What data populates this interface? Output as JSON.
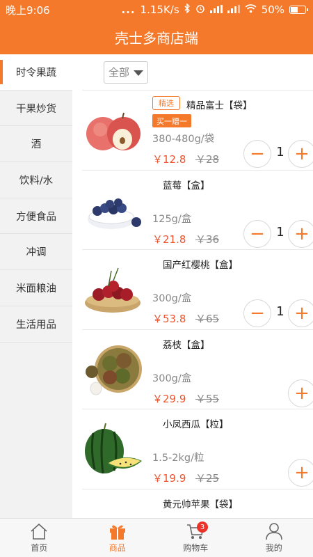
{
  "status_bar": {
    "time": "晚上9:06",
    "dots": "...",
    "network_speed": "1.15K/s",
    "battery": "50%",
    "battery_level": 0.5
  },
  "header": {
    "title": "壳士多商店端"
  },
  "colors": {
    "accent": "#f5792a",
    "price": "#f0532c",
    "badge": "#e8322a"
  },
  "sidebar": {
    "items": [
      {
        "label": "时令果蔬",
        "active": true
      },
      {
        "label": "干果炒货"
      },
      {
        "label": "酒"
      },
      {
        "label": "饮料/水"
      },
      {
        "label": "方便食品"
      },
      {
        "label": "冲调"
      },
      {
        "label": "米面粮油"
      },
      {
        "label": "生活用品"
      }
    ]
  },
  "filter": {
    "selected": "全部"
  },
  "products": [
    {
      "name": "精品富士【袋】",
      "tag": "精选",
      "promo": "买一赠一",
      "spec": "380-480g/袋",
      "price": "￥12.8",
      "old_price": "￥28",
      "qty": "1",
      "image": "apple"
    },
    {
      "name": "蓝莓【盒】",
      "spec": "125g/盒",
      "price": "￥21.8",
      "old_price": "￥36",
      "qty": "1",
      "image": "blueberry"
    },
    {
      "name": "国产红樱桃【盒】",
      "spec": "300g/盒",
      "price": "￥53.8",
      "old_price": "￥65",
      "qty": "1",
      "image": "cherry"
    },
    {
      "name": "荔枝【盒】",
      "spec": "300g/盒",
      "price": "￥29.9",
      "old_price": "￥55",
      "image": "lychee"
    },
    {
      "name": "小凤西瓜【粒】",
      "spec": "1.5-2kg/粒",
      "price": "￥19.9",
      "old_price": "￥25",
      "image": "watermelon"
    },
    {
      "name": "黄元帅苹果【袋】",
      "image": "yellow-apple"
    }
  ],
  "bottom_nav": {
    "items": [
      {
        "label": "首页",
        "icon": "home-icon"
      },
      {
        "label": "商品",
        "icon": "gift-icon",
        "active": true
      },
      {
        "label": "购物车",
        "icon": "cart-icon",
        "badge": "3"
      },
      {
        "label": "我的",
        "icon": "user-icon"
      }
    ]
  }
}
